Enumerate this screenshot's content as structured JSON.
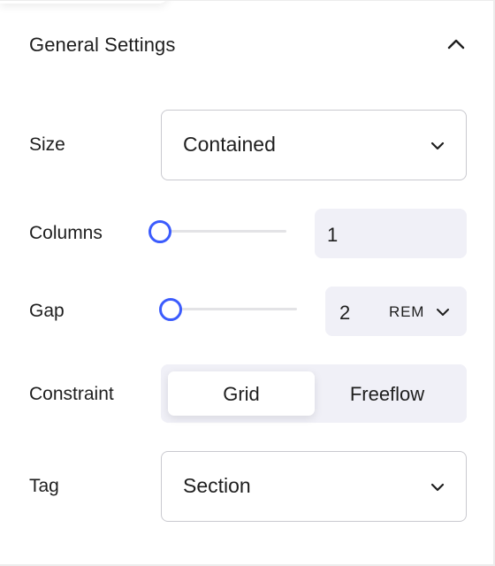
{
  "section": {
    "title": "General Settings"
  },
  "size": {
    "label": "Size",
    "value": "Contained"
  },
  "columns": {
    "label": "Columns",
    "value": "1",
    "slider_fraction": 0.0
  },
  "gap": {
    "label": "Gap",
    "value": "2",
    "unit": "REM",
    "slider_fraction": 0.0
  },
  "constraint": {
    "label": "Constraint",
    "options": [
      "Grid",
      "Freeflow"
    ],
    "selected": "Grid"
  },
  "tag": {
    "label": "Tag",
    "value": "Section"
  },
  "colors": {
    "accent": "#3b5bfd",
    "input_bg": "#f0f0f7",
    "border": "#c9c9cf",
    "text": "#1e1e1e"
  },
  "icons": {
    "collapse": "chevron-up-icon",
    "dropdown": "chevron-down-icon"
  }
}
